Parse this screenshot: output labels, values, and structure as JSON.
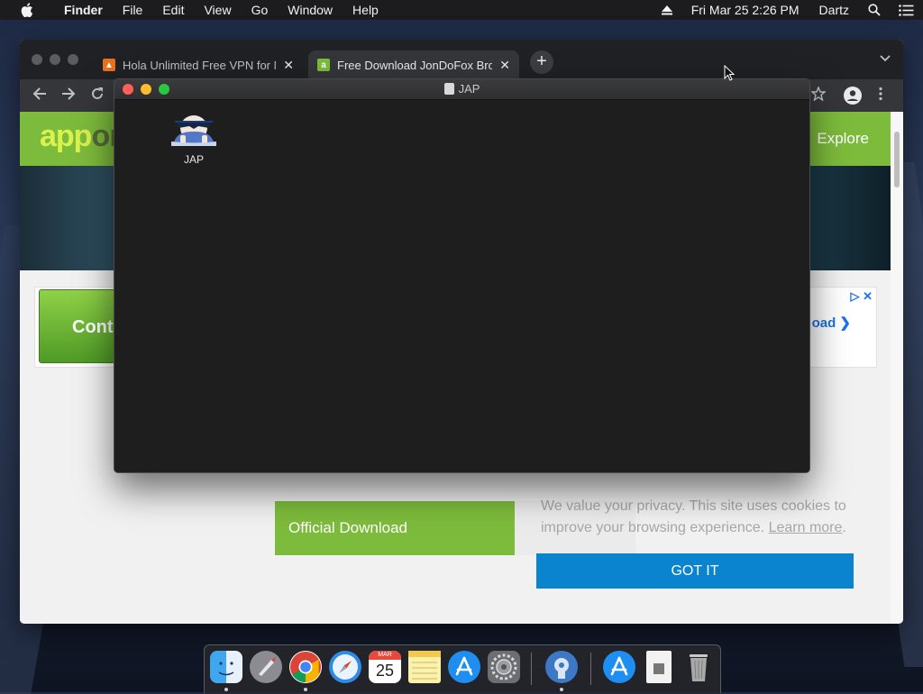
{
  "menubar": {
    "app_name": "Finder",
    "menus": [
      "File",
      "Edit",
      "View",
      "Go",
      "Window",
      "Help"
    ],
    "clock": "Fri Mar 25  2:26 PM",
    "user": "Dartz",
    "icons": [
      "apple-icon",
      "eject-icon",
      "spotlight-search-icon",
      "notification-center-icon"
    ]
  },
  "browser": {
    "tabs": [
      {
        "title": "Hola Unlimited Free VPN for Mac",
        "favicon_color": "#e8711c",
        "active": false
      },
      {
        "title": "Free Download JonDoFox Browser",
        "favicon_color": "#7dbb3c",
        "favicon_letter": "a",
        "active": true
      }
    ],
    "new_tab_label": "+",
    "toolbar_icons": [
      "back-arrow-icon",
      "forward-arrow-icon",
      "reload-icon",
      "bookmark-star-icon",
      "profile-icon",
      "kebab-menu-icon"
    ]
  },
  "site": {
    "logo_text_a": "app",
    "logo_text_b": "or",
    "nav_explore": "Explore",
    "ad_button": "Cont",
    "ad_link": "oad",
    "official_download": "Official Download",
    "cookie_text": "We value your privacy. This site uses cookies to improve your browsing experience.",
    "cookie_learn_more": "Learn more",
    "cookie_period": ".",
    "got_it": "GOT IT"
  },
  "finder_window": {
    "title": "JAP",
    "items": [
      {
        "label": "JAP",
        "icon": "jap-app-icon"
      }
    ]
  },
  "dock": {
    "apps": [
      "finder-icon",
      "launchpad-icon",
      "chrome-icon",
      "safari-icon",
      "calendar-icon",
      "notes-icon",
      "app-store-icon",
      "system-preferences-icon",
      "jap-installer-icon",
      "applications-folder-icon",
      "document-icon",
      "trash-icon"
    ],
    "calendar_month": "MAR",
    "calendar_day": "25"
  },
  "colors": {
    "site_green": "#7dbb3c",
    "got_it_blue": "#0b84d0",
    "close_red": "#ff5f57",
    "minimize_yellow": "#febc2e",
    "zoom_green": "#28c840"
  }
}
